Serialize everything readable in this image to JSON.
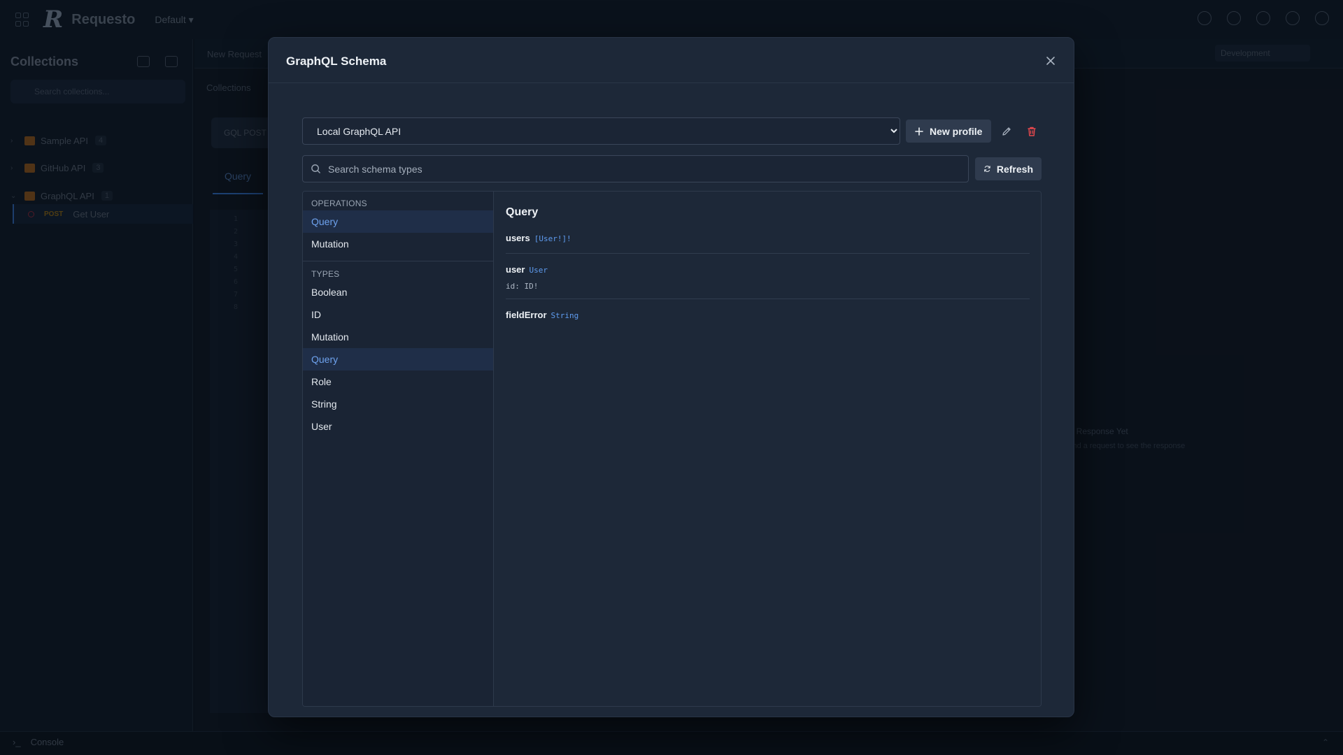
{
  "app": {
    "name": "Requesto",
    "workspace": "Default"
  },
  "sidebar": {
    "title": "Collections",
    "search_placeholder": "Search collections...",
    "collections": [
      {
        "name": "Sample API",
        "count": "4"
      },
      {
        "name": "GitHub API",
        "count": "3"
      },
      {
        "name": "GraphQL API",
        "count": "1"
      }
    ],
    "request": {
      "method": "POST",
      "name": "Get User"
    }
  },
  "background": {
    "tab": "New Request",
    "env": "Development",
    "breadcrumb": "Collections",
    "method_box": "GQL POST",
    "query_tab": "Query",
    "empty_title": "No Response Yet",
    "empty_sub": "Send a request to see the response",
    "console": "Console"
  },
  "modal": {
    "title": "GraphQL Schema",
    "profile": {
      "selected": "Local GraphQL API",
      "options": [
        "Local GraphQL API"
      ]
    },
    "new_profile_label": "New profile",
    "search_placeholder": "Search schema types",
    "refresh_label": "Refresh",
    "operations_label": "OPERATIONS",
    "operations": [
      "Query",
      "Mutation"
    ],
    "types_label": "TYPES",
    "types": [
      "Boolean",
      "ID",
      "Mutation",
      "Query",
      "Role",
      "String",
      "User"
    ],
    "selected_type": {
      "name": "Query",
      "fields": [
        {
          "name": "users",
          "type": "[User!]!",
          "arg": ""
        },
        {
          "name": "user",
          "type": "User",
          "arg": "id: ID!"
        },
        {
          "name": "fieldError",
          "type": "String",
          "arg": ""
        }
      ]
    }
  },
  "colors": {
    "accent": "#6ea2ee",
    "danger": "#e5484d",
    "modal_bg": "#1d2838"
  }
}
